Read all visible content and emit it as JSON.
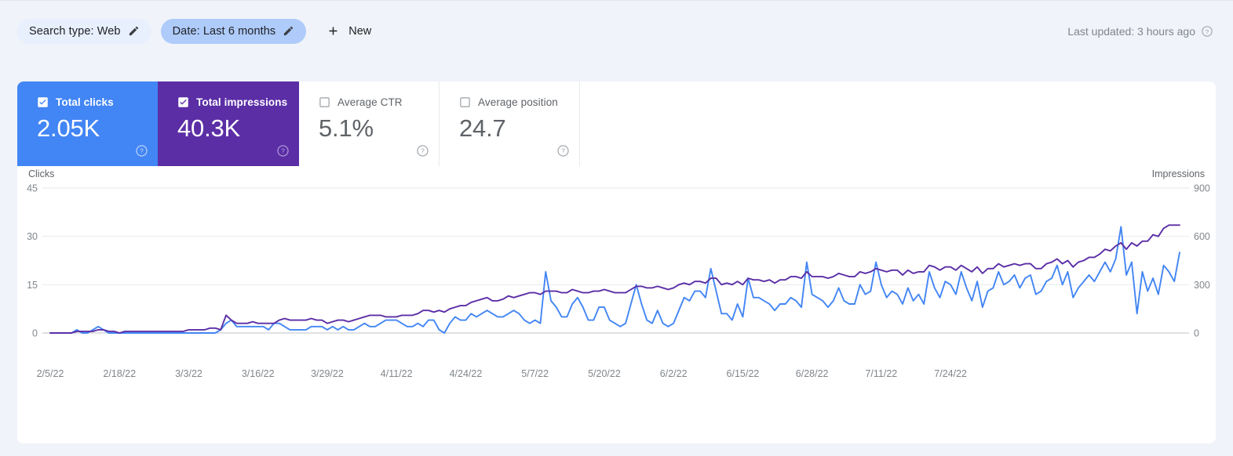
{
  "filters": {
    "chips": [
      {
        "label": "Search type: Web",
        "style": "light",
        "icon": "pencil-icon"
      },
      {
        "label": "Date: Last 6 months",
        "style": "dark",
        "icon": "pencil-icon"
      }
    ],
    "new_button": {
      "label": "New",
      "icon": "plus-icon"
    },
    "last_updated": {
      "text": "Last updated: 3 hours ago",
      "icon": "help-circle-icon"
    }
  },
  "metrics": [
    {
      "label": "Total clicks",
      "value": "2.05K",
      "checked": true,
      "state": "sel-blue",
      "color": "#4285f4",
      "help_icon": "help-circle-icon"
    },
    {
      "label": "Total impressions",
      "value": "40.3K",
      "checked": true,
      "state": "sel-purple",
      "color": "#5b2ea6",
      "help_icon": "help-circle-icon"
    },
    {
      "label": "Average CTR",
      "value": "5.1%",
      "checked": false,
      "state": "unsel",
      "color": "#5f6368",
      "help_icon": "help-circle-icon"
    },
    {
      "label": "Average position",
      "value": "24.7",
      "checked": false,
      "state": "unsel",
      "color": "#5f6368",
      "help_icon": "help-circle-icon"
    }
  ],
  "chart_data": {
    "type": "line",
    "title": "",
    "xlabel": "",
    "ylabel": "Clicks",
    "y2label": "Impressions",
    "grid": true,
    "legend": "none",
    "left_axis": {
      "label": "Clicks",
      "ticks": [
        "0",
        "15",
        "30",
        "45"
      ],
      "ylim": [
        0,
        45
      ]
    },
    "right_axis": {
      "label": "Impressions",
      "ticks": [
        "0",
        "300",
        "600",
        "900"
      ],
      "ylim": [
        0,
        900
      ]
    },
    "x_tick_labels": [
      "2/5/22",
      "2/18/22",
      "3/3/22",
      "3/16/22",
      "3/29/22",
      "4/11/22",
      "4/24/22",
      "5/7/22",
      "5/20/22",
      "6/2/22",
      "6/15/22",
      "6/28/22",
      "7/11/22",
      "7/24/22"
    ],
    "x_tick_indices": [
      0,
      13,
      26,
      39,
      52,
      65,
      78,
      91,
      104,
      117,
      130,
      143,
      156,
      169
    ],
    "series": [
      {
        "name": "Clicks",
        "color": "#4285f4",
        "axis": "left",
        "values": [
          0,
          0,
          0,
          0,
          0,
          1,
          0,
          0,
          1,
          2,
          1,
          0,
          0,
          0,
          0,
          0,
          0,
          0,
          0,
          0,
          0,
          0,
          0,
          0,
          0,
          0,
          0,
          0,
          0,
          0,
          0,
          0,
          1,
          3,
          4,
          2,
          2,
          2,
          2,
          2,
          2,
          1,
          3,
          3,
          2,
          1,
          1,
          1,
          1,
          2,
          2,
          2,
          1,
          2,
          1,
          2,
          1,
          1,
          2,
          3,
          2,
          2,
          3,
          4,
          4,
          4,
          3,
          2,
          2,
          3,
          2,
          4,
          4,
          1,
          0,
          3,
          5,
          4,
          4,
          6,
          5,
          6,
          7,
          6,
          5,
          5,
          6,
          7,
          6,
          4,
          3,
          4,
          3,
          19,
          10,
          8,
          5,
          5,
          9,
          11,
          8,
          4,
          4,
          8,
          8,
          4,
          3,
          2,
          3,
          9,
          15,
          9,
          4,
          3,
          7,
          3,
          2,
          3,
          7,
          11,
          10,
          13,
          13,
          11,
          20,
          13,
          6,
          6,
          4,
          9,
          5,
          17,
          11,
          11,
          10,
          9,
          7,
          9,
          9,
          11,
          10,
          8,
          22,
          12,
          11,
          10,
          8,
          10,
          14,
          10,
          9,
          9,
          15,
          12,
          13,
          22,
          15,
          11,
          13,
          12,
          9,
          14,
          10,
          12,
          9,
          19,
          14,
          11,
          16,
          15,
          12,
          19,
          14,
          10,
          16,
          8,
          13,
          14,
          19,
          15,
          16,
          18,
          14,
          17,
          18,
          12,
          13,
          16,
          17,
          21,
          15,
          19,
          11,
          14,
          16,
          18,
          16,
          19,
          22,
          19,
          23,
          33,
          18,
          22,
          6,
          19,
          13,
          17,
          12,
          21,
          19,
          16,
          25
        ]
      },
      {
        "name": "Impressions",
        "color": "#5b2ea6",
        "axis": "right",
        "values": [
          0,
          0,
          0,
          0,
          0,
          10,
          10,
          10,
          10,
          20,
          20,
          10,
          10,
          0,
          10,
          10,
          10,
          10,
          10,
          10,
          10,
          10,
          10,
          10,
          10,
          10,
          20,
          20,
          20,
          20,
          30,
          30,
          20,
          110,
          80,
          60,
          60,
          60,
          70,
          60,
          60,
          60,
          60,
          80,
          90,
          80,
          80,
          80,
          80,
          90,
          80,
          80,
          60,
          70,
          80,
          80,
          70,
          80,
          90,
          100,
          110,
          110,
          110,
          100,
          100,
          100,
          110,
          110,
          110,
          120,
          140,
          140,
          130,
          140,
          130,
          150,
          160,
          170,
          170,
          190,
          200,
          210,
          220,
          200,
          200,
          210,
          230,
          220,
          230,
          240,
          250,
          250,
          240,
          260,
          260,
          260,
          250,
          250,
          270,
          260,
          250,
          250,
          260,
          260,
          270,
          260,
          250,
          250,
          250,
          270,
          290,
          290,
          280,
          280,
          290,
          280,
          270,
          280,
          300,
          310,
          300,
          320,
          320,
          310,
          340,
          340,
          300,
          310,
          300,
          320,
          300,
          340,
          330,
          330,
          320,
          330,
          310,
          330,
          330,
          350,
          350,
          340,
          380,
          350,
          350,
          350,
          340,
          350,
          370,
          360,
          350,
          350,
          380,
          370,
          380,
          400,
          390,
          380,
          390,
          390,
          360,
          390,
          370,
          380,
          380,
          420,
          410,
          390,
          410,
          410,
          390,
          420,
          400,
          380,
          410,
          370,
          400,
          400,
          430,
          410,
          420,
          430,
          420,
          430,
          430,
          400,
          400,
          430,
          440,
          460,
          430,
          450,
          410,
          440,
          450,
          470,
          470,
          490,
          520,
          510,
          540,
          560,
          520,
          560,
          540,
          570,
          570,
          610,
          600,
          650,
          670,
          670,
          670
        ]
      }
    ]
  }
}
